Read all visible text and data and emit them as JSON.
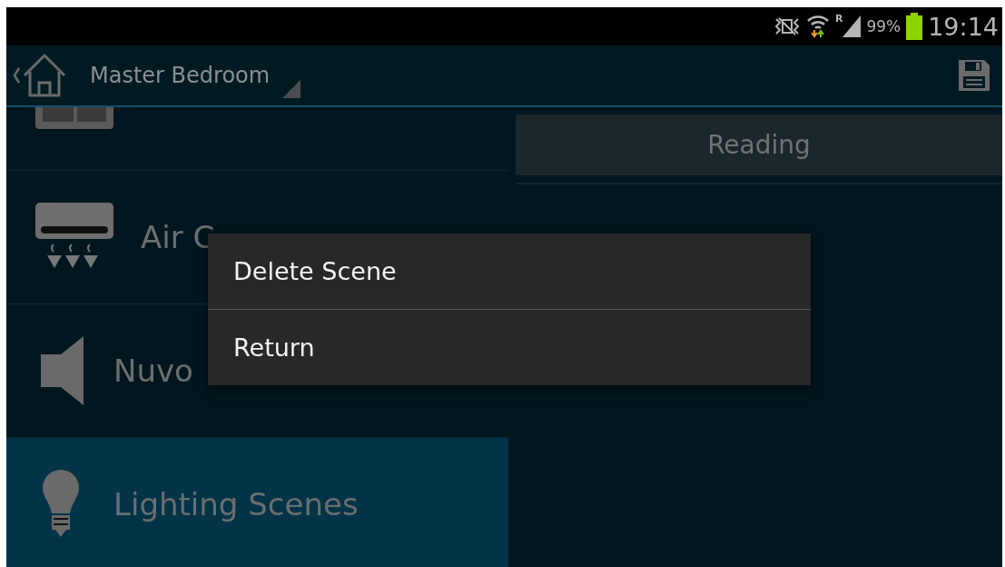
{
  "status_bar": {
    "roaming": "R",
    "battery": "99%",
    "time": "19:14"
  },
  "action_bar": {
    "title": "Master Bedroom"
  },
  "categories": [
    {
      "kind": "motor",
      "selected": false
    },
    {
      "label": "Air C",
      "kind": "aircon",
      "selected": false
    },
    {
      "label": "Nuvo",
      "kind": "speaker",
      "selected": false
    },
    {
      "label": "Lighting Scenes",
      "kind": "bulb",
      "selected": true
    }
  ],
  "scenes": [
    {
      "label": "Reading",
      "selected": false
    }
  ],
  "context_menu": {
    "items": [
      "Delete Scene",
      "Return"
    ]
  }
}
